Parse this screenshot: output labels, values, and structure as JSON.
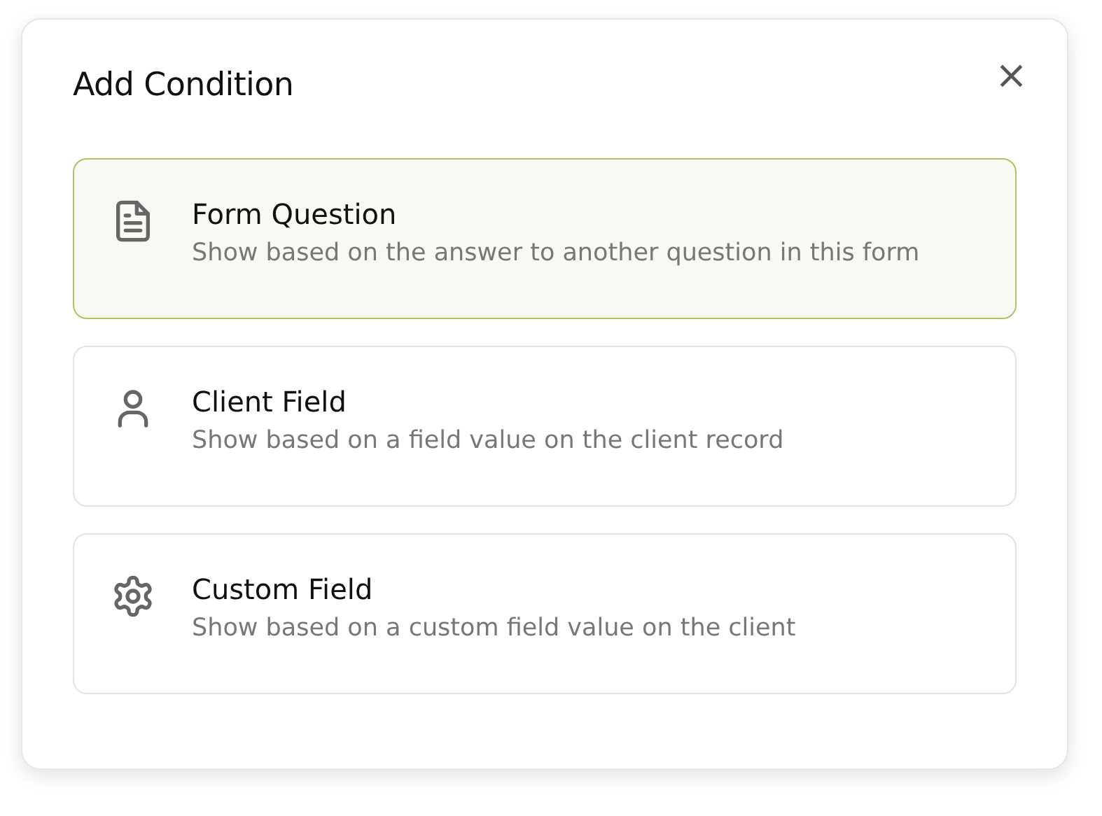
{
  "dialog": {
    "title": "Add Condition",
    "close_label": "×"
  },
  "options": [
    {
      "kind": "document",
      "title": "Form Question",
      "description": "Show based on the answer to another question in this form",
      "selected": true
    },
    {
      "kind": "person",
      "title": "Client Field",
      "description": "Show based on a field value on the client record",
      "selected": false
    },
    {
      "kind": "gear",
      "title": "Custom Field",
      "description": "Show based on a custom field value on the client",
      "selected": false
    }
  ]
}
